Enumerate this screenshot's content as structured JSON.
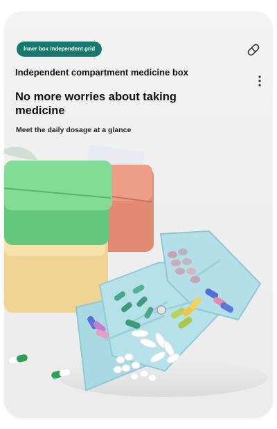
{
  "badge": {
    "label": "Inner box independent grid"
  },
  "title": "Independent compartment medicine box",
  "headline": "No more worries about taking medicine",
  "subtitle": "Meet the daily dosage at a glance",
  "icons": {
    "top_right": "pill-icon",
    "menu": "more-vertical-icon"
  },
  "colors": {
    "accent": "#157a6c",
    "box_green": "#7cd98f",
    "box_coral": "#e9927a",
    "box_yellow": "#f7dfa5",
    "box_blue": "#b9e3ea"
  }
}
